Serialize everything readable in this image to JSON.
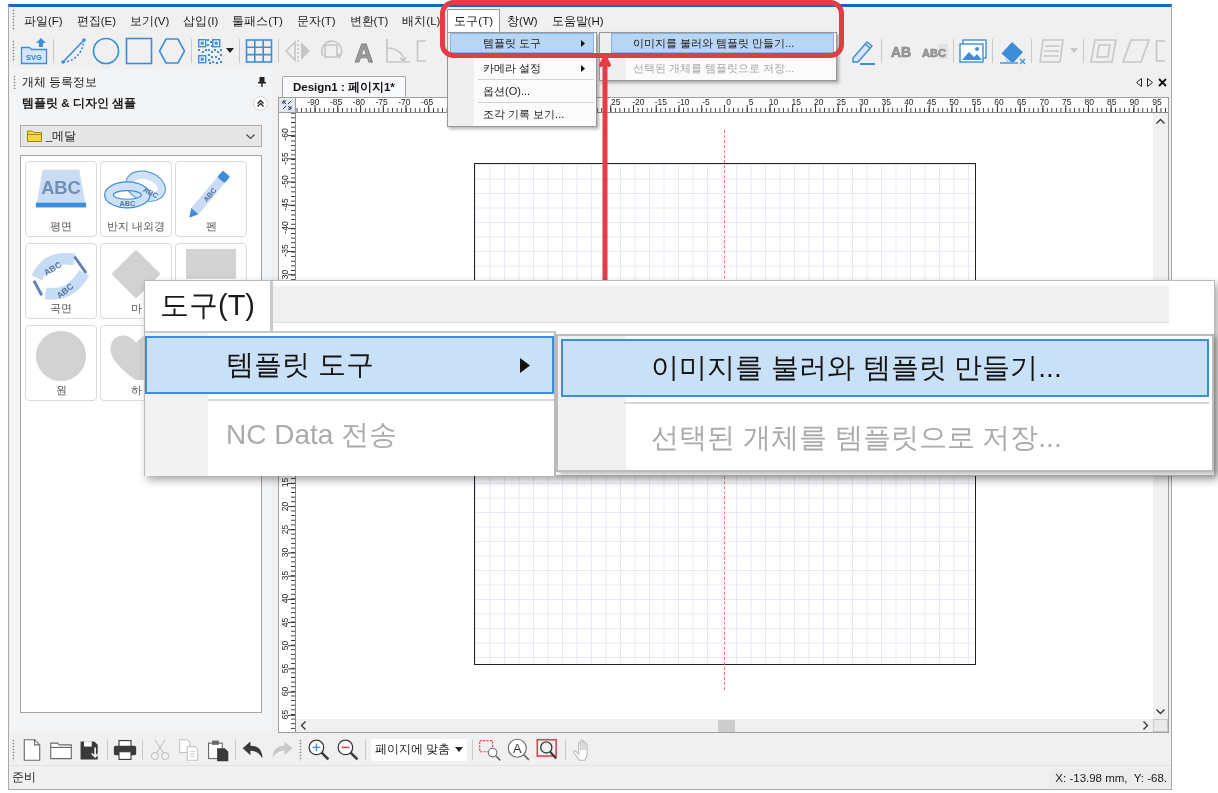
{
  "menu_bar": [
    {
      "label": "파일(F)",
      "open": false
    },
    {
      "label": "편집(E)",
      "open": false
    },
    {
      "label": "보기(V)",
      "open": false
    },
    {
      "label": "삽입(I)",
      "open": false
    },
    {
      "label": "툴패스(T)",
      "open": false
    },
    {
      "label": "문자(T)",
      "open": false
    },
    {
      "label": "변환(T)",
      "open": false
    },
    {
      "label": "배치(L)",
      "open": false
    },
    {
      "label": "도구(T)",
      "open": true
    },
    {
      "label": "창(W)",
      "open": false
    },
    {
      "label": "도움말(H)",
      "open": false
    }
  ],
  "toolbar": [
    {
      "items": [
        {
          "kind": "grip"
        },
        {
          "kind": "svg-import",
          "text": "SVG",
          "disabled": false
        },
        {
          "kind": "separator"
        },
        {
          "kind": "arc",
          "disabled": false
        },
        {
          "kind": "circle",
          "disabled": false
        },
        {
          "kind": "square",
          "disabled": false
        },
        {
          "kind": "hexagon",
          "disabled": false
        },
        {
          "kind": "separator"
        },
        {
          "kind": "qr-code",
          "disabled": false
        },
        {
          "kind": "caret",
          "disabled": false
        },
        {
          "kind": "separator"
        },
        {
          "kind": "table",
          "disabled": false
        },
        {
          "kind": "separator"
        },
        {
          "kind": "mirror",
          "disabled": true
        },
        {
          "kind": "rotate",
          "disabled": true
        },
        {
          "kind": "letter",
          "text": "A",
          "disabled": true
        },
        {
          "kind": "angle",
          "disabled": true
        },
        {
          "kind": "frame-part",
          "disabled": true
        }
      ]
    },
    {
      "items": [
        {
          "kind": "pencil",
          "disabled": false
        },
        {
          "kind": "separator"
        },
        {
          "kind": "outline-text",
          "text": "AB",
          "disabled": true
        },
        {
          "kind": "boxed-text",
          "text": "ABC",
          "disabled": true
        },
        {
          "kind": "separator"
        },
        {
          "kind": "image",
          "disabled": false
        },
        {
          "kind": "separator"
        },
        {
          "kind": "eraser",
          "disabled": false
        },
        {
          "kind": "separator"
        },
        {
          "kind": "layers",
          "disabled": true
        },
        {
          "kind": "caret",
          "disabled": true
        },
        {
          "kind": "separator"
        },
        {
          "kind": "frame",
          "disabled": true
        },
        {
          "kind": "slanted-frame",
          "disabled": true
        },
        {
          "kind": "frame-part",
          "disabled": true
        }
      ]
    }
  ],
  "side_panel": {
    "title": "개체 등록정보",
    "section": "템플릿 & 디자인 샘플",
    "category": "_메달",
    "tiles": [
      {
        "kind": "flat",
        "label": "평면",
        "art_text": [
          "ABC"
        ]
      },
      {
        "kind": "ring",
        "label": "반지 내외경",
        "art_text": [
          "ABC",
          "ABC"
        ]
      },
      {
        "kind": "pen",
        "label": "펜",
        "art_text": [
          "ABC"
        ]
      },
      {
        "kind": "curved",
        "label": "곡면",
        "art_text": [
          "ABC",
          "ABC"
        ]
      },
      {
        "kind": "diamond",
        "label": "마"
      },
      {
        "kind": "square"
      },
      {
        "kind": "circle",
        "label": "원"
      },
      {
        "kind": "heart",
        "label": "하"
      }
    ]
  },
  "document_tabs": [
    {
      "label": "Design1 : 페이지1*",
      "selected": true
    }
  ],
  "top_ruler": {
    "left_labels": [
      "-90",
      "-85",
      "-80",
      "-75",
      "-70",
      "-65"
    ],
    "right_labels": [
      "25",
      "-20",
      "-15",
      "-10",
      "-5",
      "0",
      "5",
      "10",
      "15",
      "20",
      "25",
      "30",
      "35",
      "40",
      "45",
      "50",
      "55",
      "60",
      "65",
      "70",
      "75",
      "80",
      "85",
      "90",
      "95"
    ]
  },
  "left_ruler": {
    "upper_labels": [
      "-60",
      "-55",
      "-50",
      "-45",
      "-40",
      "-35",
      "30"
    ],
    "lower_labels": [
      "15",
      "20",
      "25",
      "30",
      "35",
      "40",
      "45",
      "50",
      "55",
      "60",
      "65"
    ]
  },
  "bottom_toolbar": [
    {
      "kind": "grip"
    },
    {
      "kind": "new-file",
      "disabled": false
    },
    {
      "kind": "open-folder",
      "disabled": false
    },
    {
      "kind": "save",
      "disabled": false
    },
    {
      "kind": "separator"
    },
    {
      "kind": "print",
      "disabled": false
    },
    {
      "kind": "separator"
    },
    {
      "kind": "cut",
      "disabled": true
    },
    {
      "kind": "copy",
      "disabled": true
    },
    {
      "kind": "paste",
      "disabled": false
    },
    {
      "kind": "separator"
    },
    {
      "kind": "undo",
      "disabled": false
    },
    {
      "kind": "redo",
      "disabled": true
    },
    {
      "kind": "grip"
    },
    {
      "kind": "zoom-in",
      "disabled": false
    },
    {
      "kind": "zoom-out",
      "disabled": false
    },
    {
      "kind": "separator"
    },
    {
      "kind": "select",
      "value": "페이지에 맞춤"
    },
    {
      "kind": "separator"
    },
    {
      "kind": "zoom-area",
      "disabled": false
    },
    {
      "kind": "zoom-text",
      "text": "A",
      "disabled": false
    },
    {
      "kind": "zoom-frame",
      "disabled": false
    },
    {
      "kind": "separator"
    },
    {
      "kind": "hand",
      "disabled": true
    }
  ],
  "status_bar": {
    "message": "준비",
    "coordinates": "X: -13.98 mm,  Y: -68."
  },
  "tools_menu": {
    "items": [
      {
        "kind": "item",
        "label": "템플릿 도구",
        "selected": true,
        "disabled": false,
        "has_submenu": true
      },
      {
        "kind": "item",
        "label": "카메라 설정",
        "selected": false,
        "disabled": false,
        "has_submenu": true
      },
      {
        "kind": "separator"
      },
      {
        "kind": "item",
        "label": "옵션(O)...",
        "selected": false,
        "disabled": false,
        "has_submenu": false
      },
      {
        "kind": "separator"
      },
      {
        "kind": "item",
        "label": "조각 기록 보기...",
        "selected": false,
        "disabled": false,
        "has_submenu": false
      }
    ]
  },
  "submenu": {
    "items": [
      {
        "kind": "item",
        "label": "이미지를 불러와 템플릿 만들기...",
        "selected": true,
        "disabled": false
      },
      {
        "kind": "item",
        "label": "선택된 개체를 템플릿으로 저장...",
        "selected": false,
        "disabled": true
      }
    ]
  },
  "zoom_callout": {
    "menu_title": "도구(T)",
    "menu_items": [
      {
        "kind": "item",
        "label": "템플릿 도구",
        "selected": true,
        "disabled": false,
        "has_submenu": true
      },
      {
        "kind": "separator"
      },
      {
        "kind": "item",
        "label": "NC Data 전송",
        "selected": false,
        "disabled": true,
        "has_submenu": false
      }
    ],
    "submenu_items": [
      {
        "kind": "item",
        "label": "이미지를 불러와 템플릿 만들기...",
        "selected": true,
        "disabled": false
      },
      {
        "kind": "separator"
      },
      {
        "kind": "item",
        "label": "선택된 개체를 템플릿으로 저장...",
        "selected": false,
        "disabled": true
      }
    ]
  }
}
